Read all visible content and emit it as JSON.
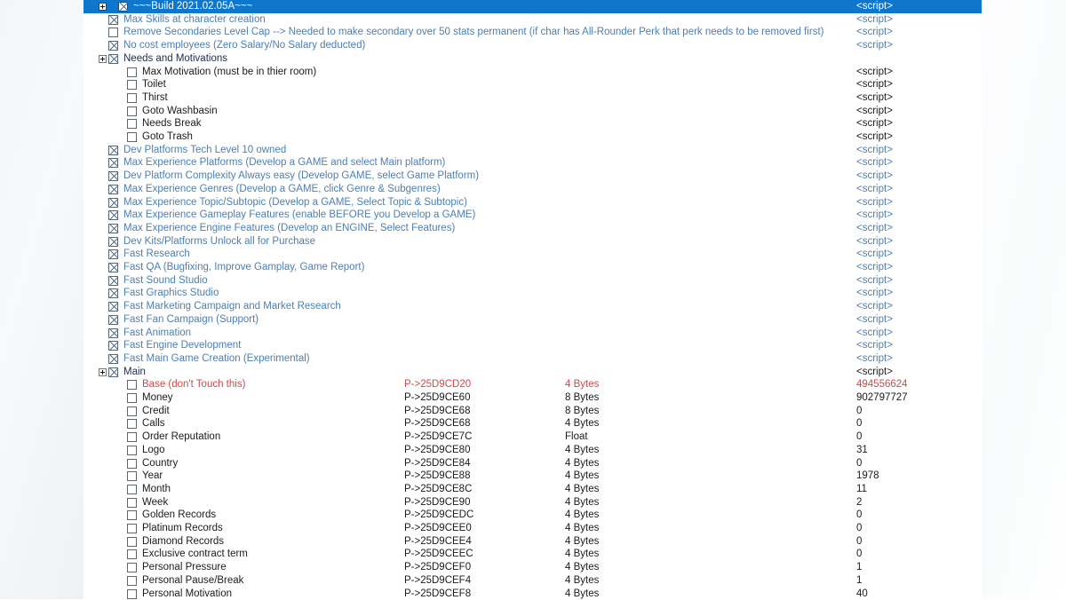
{
  "window": {
    "title": "~~~Build 2021.02.05A~~~",
    "selection_color": "#0e77cc",
    "script_text": "<script>",
    "blue_text_color": "#4c7fb5",
    "red_text_color": "#cc4b4b"
  },
  "rows": [
    {
      "indent": 0,
      "expander": true,
      "checkbox": "checked-blue",
      "desc": "~~~Build 2021.02.05A~~~",
      "desc_color": "white",
      "script": "<script>",
      "script_color": "white",
      "selected": true
    },
    {
      "indent": 1,
      "expander": false,
      "checkbox": "checked-blue",
      "desc": "Max Skills at character creation",
      "desc_color": "blue",
      "script": "<script>",
      "script_color": "blue"
    },
    {
      "indent": 1,
      "expander": false,
      "checkbox": "unchecked",
      "desc": "Remove Secondaries Level Cap --> Needed to make secondary over 50 stats permanent (if char has All-Rounder Perk that perk needs to be removed first)",
      "desc_color": "blue",
      "script": "<script>",
      "script_color": "blue"
    },
    {
      "indent": 1,
      "expander": false,
      "checkbox": "checked-blue",
      "desc": "No cost employees (Zero Salary/No Salary deducted)",
      "desc_color": "blue",
      "script": "<script>",
      "script_color": "blue"
    },
    {
      "indent": 1,
      "expander": true,
      "checkbox": "checked-blue",
      "desc": "Needs and Motivations",
      "desc_color": "dark",
      "script": ""
    },
    {
      "indent": 2,
      "expander": false,
      "checkbox": "unchecked",
      "desc": "Max Motivation (must be in thier room)",
      "desc_color": "black",
      "script": "<script>",
      "script_color": "black"
    },
    {
      "indent": 2,
      "expander": false,
      "checkbox": "unchecked",
      "desc": "Toilet",
      "desc_color": "black",
      "script": "<script>",
      "script_color": "black"
    },
    {
      "indent": 2,
      "expander": false,
      "checkbox": "unchecked",
      "desc": "Thirst",
      "desc_color": "black",
      "script": "<script>",
      "script_color": "black"
    },
    {
      "indent": 2,
      "expander": false,
      "checkbox": "unchecked",
      "desc": "Goto Washbasin",
      "desc_color": "black",
      "script": "<script>",
      "script_color": "black"
    },
    {
      "indent": 2,
      "expander": false,
      "checkbox": "unchecked",
      "desc": "Needs Break",
      "desc_color": "black",
      "script": "<script>",
      "script_color": "black"
    },
    {
      "indent": 2,
      "expander": false,
      "checkbox": "unchecked",
      "desc": "Goto Trash",
      "desc_color": "black",
      "script": "<script>",
      "script_color": "black"
    },
    {
      "indent": 1,
      "expander": false,
      "checkbox": "checked-blue",
      "desc": "Dev Platforms Tech Level 10 owned",
      "desc_color": "blue",
      "script": "<script>",
      "script_color": "blue"
    },
    {
      "indent": 1,
      "expander": false,
      "checkbox": "checked-blue",
      "desc": "Max Experience Platforms  (Develop a GAME and select Main platform)",
      "desc_color": "blue",
      "script": "<script>",
      "script_color": "blue"
    },
    {
      "indent": 1,
      "expander": false,
      "checkbox": "checked-blue",
      "desc": "Dev Platform Complexity Always easy (Develop GAME, select Game Platform)",
      "desc_color": "blue",
      "script": "<script>",
      "script_color": "blue"
    },
    {
      "indent": 1,
      "expander": false,
      "checkbox": "checked-blue",
      "desc": "Max Experience Genres (Develop a GAME, click Genre & Subgenres)",
      "desc_color": "blue",
      "script": "<script>",
      "script_color": "blue"
    },
    {
      "indent": 1,
      "expander": false,
      "checkbox": "checked-blue",
      "desc": "Max Experience Topic/Subtopic (Develop a GAME, Select Topic & Subtopic)",
      "desc_color": "blue",
      "script": "<script>",
      "script_color": "blue"
    },
    {
      "indent": 1,
      "expander": false,
      "checkbox": "checked-blue",
      "desc": "Max Experience Gameplay Features (enable BEFORE you Develop a GAME)",
      "desc_color": "blue",
      "script": "<script>",
      "script_color": "blue"
    },
    {
      "indent": 1,
      "expander": false,
      "checkbox": "checked-blue",
      "desc": "Max Experience Engine Features (Develop an ENGINE, Select Features)",
      "desc_color": "blue",
      "script": "<script>",
      "script_color": "blue"
    },
    {
      "indent": 1,
      "expander": false,
      "checkbox": "checked-blue",
      "desc": "Dev Kits/Platforms Unlock all for Purchase",
      "desc_color": "blue",
      "script": "<script>",
      "script_color": "blue"
    },
    {
      "indent": 1,
      "expander": false,
      "checkbox": "checked-blue",
      "desc": "Fast Research",
      "desc_color": "blue",
      "script": "<script>",
      "script_color": "blue"
    },
    {
      "indent": 1,
      "expander": false,
      "checkbox": "checked-blue",
      "desc": "Fast QA (Bugfixing, Improve Gamplay, Game Report)",
      "desc_color": "blue",
      "script": "<script>",
      "script_color": "blue"
    },
    {
      "indent": 1,
      "expander": false,
      "checkbox": "checked-blue",
      "desc": "Fast Sound Studio",
      "desc_color": "blue",
      "script": "<script>",
      "script_color": "blue"
    },
    {
      "indent": 1,
      "expander": false,
      "checkbox": "checked-blue",
      "desc": "Fast Graphics Studio",
      "desc_color": "blue",
      "script": "<script>",
      "script_color": "blue"
    },
    {
      "indent": 1,
      "expander": false,
      "checkbox": "checked-blue",
      "desc": "Fast Marketing Campaign and Market Research",
      "desc_color": "blue",
      "script": "<script>",
      "script_color": "blue"
    },
    {
      "indent": 1,
      "expander": false,
      "checkbox": "checked-blue",
      "desc": "Fast Fan Campaign (Support)",
      "desc_color": "blue",
      "script": "<script>",
      "script_color": "blue"
    },
    {
      "indent": 1,
      "expander": false,
      "checkbox": "checked-blue",
      "desc": "Fast Animation",
      "desc_color": "blue",
      "script": "<script>",
      "script_color": "blue"
    },
    {
      "indent": 1,
      "expander": false,
      "checkbox": "checked-blue",
      "desc": "Fast Engine Development",
      "desc_color": "blue",
      "script": "<script>",
      "script_color": "blue"
    },
    {
      "indent": 1,
      "expander": false,
      "checkbox": "checked-blue",
      "desc": "Fast Main Game Creation (Experimental)",
      "desc_color": "blue",
      "script": "<script>",
      "script_color": "blue"
    },
    {
      "indent": 1,
      "expander": true,
      "checkbox": "checked-blue",
      "desc": "Main",
      "desc_color": "dark",
      "script": "<script>",
      "script_color": "black"
    },
    {
      "indent": 2,
      "expander": false,
      "checkbox": "unchecked",
      "desc": "Base (don't Touch this)",
      "desc_color": "red",
      "address": "P->25D9CD20",
      "type": "4 Bytes",
      "value": "494556624",
      "row_color": "red"
    },
    {
      "indent": 2,
      "expander": false,
      "checkbox": "unchecked",
      "desc": "Money",
      "desc_color": "black",
      "address": "P->25D9CE60",
      "type": "8 Bytes",
      "value": "902797727"
    },
    {
      "indent": 2,
      "expander": false,
      "checkbox": "unchecked",
      "desc": "Credit",
      "desc_color": "black",
      "address": "P->25D9CE68",
      "type": "8 Bytes",
      "value": "0"
    },
    {
      "indent": 2,
      "expander": false,
      "checkbox": "unchecked",
      "desc": "Calls",
      "desc_color": "black",
      "address": "P->25D9CE68",
      "type": "4 Bytes",
      "value": "0"
    },
    {
      "indent": 2,
      "expander": false,
      "checkbox": "unchecked",
      "desc": "Order Reputation",
      "desc_color": "black",
      "address": "P->25D9CE7C",
      "type": "Float",
      "value": "0"
    },
    {
      "indent": 2,
      "expander": false,
      "checkbox": "unchecked",
      "desc": "Logo",
      "desc_color": "black",
      "address": "P->25D9CE80",
      "type": "4 Bytes",
      "value": "31"
    },
    {
      "indent": 2,
      "expander": false,
      "checkbox": "unchecked",
      "desc": "Country",
      "desc_color": "black",
      "address": "P->25D9CE84",
      "type": "4 Bytes",
      "value": "0"
    },
    {
      "indent": 2,
      "expander": false,
      "checkbox": "unchecked",
      "desc": "Year",
      "desc_color": "black",
      "address": "P->25D9CE88",
      "type": "4 Bytes",
      "value": "1978"
    },
    {
      "indent": 2,
      "expander": false,
      "checkbox": "unchecked",
      "desc": "Month",
      "desc_color": "black",
      "address": "P->25D9CE8C",
      "type": "4 Bytes",
      "value": "11"
    },
    {
      "indent": 2,
      "expander": false,
      "checkbox": "unchecked",
      "desc": "Week",
      "desc_color": "black",
      "address": "P->25D9CE90",
      "type": "4 Bytes",
      "value": "2"
    },
    {
      "indent": 2,
      "expander": false,
      "checkbox": "unchecked",
      "desc": "Golden Records",
      "desc_color": "black",
      "address": "P->25D9CEDC",
      "type": "4 Bytes",
      "value": "0"
    },
    {
      "indent": 2,
      "expander": false,
      "checkbox": "unchecked",
      "desc": "Platinum Records",
      "desc_color": "black",
      "address": "P->25D9CEE0",
      "type": "4 Bytes",
      "value": "0"
    },
    {
      "indent": 2,
      "expander": false,
      "checkbox": "unchecked",
      "desc": "Diamond Records",
      "desc_color": "black",
      "address": "P->25D9CEE4",
      "type": "4 Bytes",
      "value": "0"
    },
    {
      "indent": 2,
      "expander": false,
      "checkbox": "unchecked",
      "desc": "Exclusive contract term",
      "desc_color": "black",
      "address": "P->25D9CEEC",
      "type": "4 Bytes",
      "value": "0"
    },
    {
      "indent": 2,
      "expander": false,
      "checkbox": "unchecked",
      "desc": "Personal Pressure",
      "desc_color": "black",
      "address": "P->25D9CEF0",
      "type": "4 Bytes",
      "value": "1"
    },
    {
      "indent": 2,
      "expander": false,
      "checkbox": "unchecked",
      "desc": "Personal Pause/Break",
      "desc_color": "black",
      "address": "P->25D9CEF4",
      "type": "4 Bytes",
      "value": "1"
    },
    {
      "indent": 2,
      "expander": false,
      "checkbox": "unchecked",
      "desc": "Personal Motivation",
      "desc_color": "black",
      "address": "P->25D9CEF8",
      "type": "4 Bytes",
      "value": "40"
    }
  ]
}
